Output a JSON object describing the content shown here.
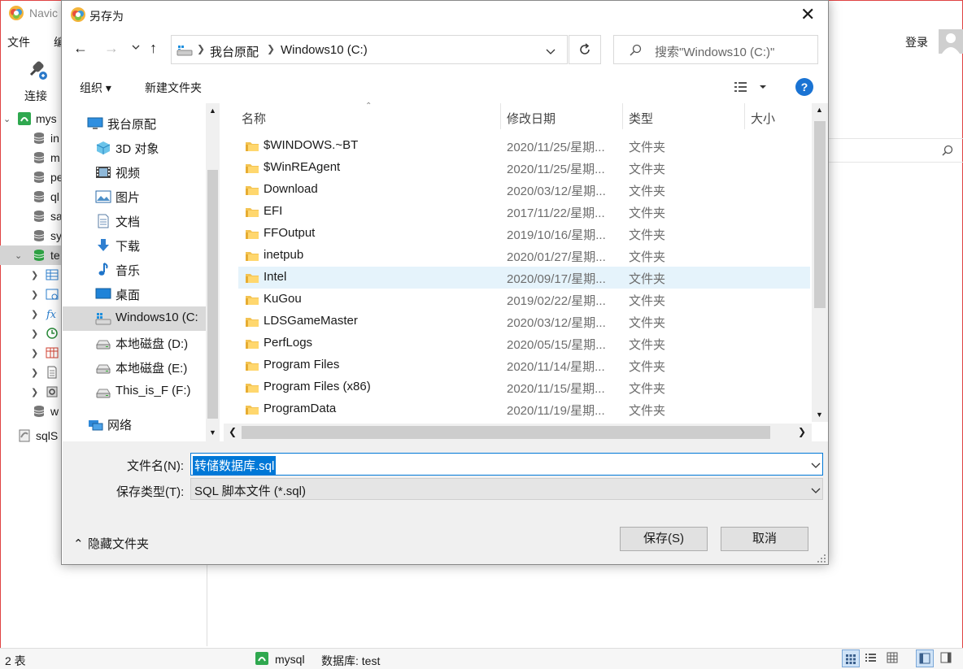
{
  "app": {
    "title": "Navic",
    "menu_file": "文件",
    "menu_edit": "编",
    "connect_label": "连接",
    "login": "登录",
    "tree": [
      {
        "label": "mys",
        "expanded": true
      },
      {
        "label": "in"
      },
      {
        "label": "m"
      },
      {
        "label": "pe"
      },
      {
        "label": "ql"
      },
      {
        "label": "sa"
      },
      {
        "label": "sy"
      },
      {
        "label": "te",
        "expanded": true
      },
      {
        "label": ""
      },
      {
        "label": ""
      },
      {
        "label": ""
      },
      {
        "label": ""
      },
      {
        "label": ""
      },
      {
        "label": ""
      },
      {
        "label": ""
      },
      {
        "label": "w"
      },
      {
        "label": "sqlS"
      }
    ],
    "status": {
      "count": "2 表",
      "connection": "mysql",
      "database": "数据库: test"
    }
  },
  "dialog": {
    "title": "另存为",
    "breadcrumb": [
      "我台原配",
      "Windows10 (C:)"
    ],
    "search_placeholder": "搜索\"Windows10 (C:)\"",
    "toolbar": {
      "organize": "组织 ▾",
      "new_folder": "新建文件夹"
    },
    "nav_items": [
      {
        "label": "我台原配",
        "icon": "computer-icon",
        "indent": 0
      },
      {
        "label": "3D 对象",
        "icon": "3d-objects-icon",
        "indent": 1
      },
      {
        "label": "视频",
        "icon": "video-icon",
        "indent": 1
      },
      {
        "label": "图片",
        "icon": "picture-icon",
        "indent": 1
      },
      {
        "label": "文档",
        "icon": "document-icon",
        "indent": 1
      },
      {
        "label": "下载",
        "icon": "download-icon",
        "indent": 1
      },
      {
        "label": "音乐",
        "icon": "music-icon",
        "indent": 1
      },
      {
        "label": "桌面",
        "icon": "desktop-icon",
        "indent": 1
      },
      {
        "label": "Windows10 (C:",
        "icon": "windows-drive-icon",
        "indent": 1,
        "selected": true
      },
      {
        "label": "本地磁盘 (D:)",
        "icon": "drive-icon",
        "indent": 1
      },
      {
        "label": "本地磁盘 (E:)",
        "icon": "drive-icon",
        "indent": 1
      },
      {
        "label": "This_is_F (F:)",
        "icon": "drive-icon",
        "indent": 1
      },
      {
        "label": "网络",
        "icon": "network-icon",
        "indent": 0
      }
    ],
    "columns": {
      "name": "名称",
      "date": "修改日期",
      "type": "类型",
      "size": "大小"
    },
    "files": [
      {
        "name": "$WINDOWS.~BT",
        "date": "2020/11/25/星期...",
        "type": "文件夹"
      },
      {
        "name": "$WinREAgent",
        "date": "2020/11/25/星期...",
        "type": "文件夹"
      },
      {
        "name": "Download",
        "date": "2020/03/12/星期...",
        "type": "文件夹"
      },
      {
        "name": "EFI",
        "date": "2017/11/22/星期...",
        "type": "文件夹"
      },
      {
        "name": "FFOutput",
        "date": "2019/10/16/星期...",
        "type": "文件夹"
      },
      {
        "name": "inetpub",
        "date": "2020/01/27/星期...",
        "type": "文件夹"
      },
      {
        "name": "Intel",
        "date": "2020/09/17/星期...",
        "type": "文件夹",
        "highlighted": true
      },
      {
        "name": "KuGou",
        "date": "2019/02/22/星期...",
        "type": "文件夹"
      },
      {
        "name": "LDSGameMaster",
        "date": "2020/03/12/星期...",
        "type": "文件夹"
      },
      {
        "name": "PerfLogs",
        "date": "2020/05/15/星期...",
        "type": "文件夹"
      },
      {
        "name": "Program Files",
        "date": "2020/11/14/星期...",
        "type": "文件夹"
      },
      {
        "name": "Program Files (x86)",
        "date": "2020/11/15/星期...",
        "type": "文件夹"
      },
      {
        "name": "ProgramData",
        "date": "2020/11/19/星期...",
        "type": "文件夹"
      }
    ],
    "filename_label": "文件名(N):",
    "filename_value": "转储数据库.sql",
    "filetype_label": "保存类型(T):",
    "filetype_value": "SQL 脚本文件 (*.sql)",
    "hide_folders": "隐藏文件夹",
    "save_button": "保存(S)",
    "cancel_button": "取消"
  }
}
